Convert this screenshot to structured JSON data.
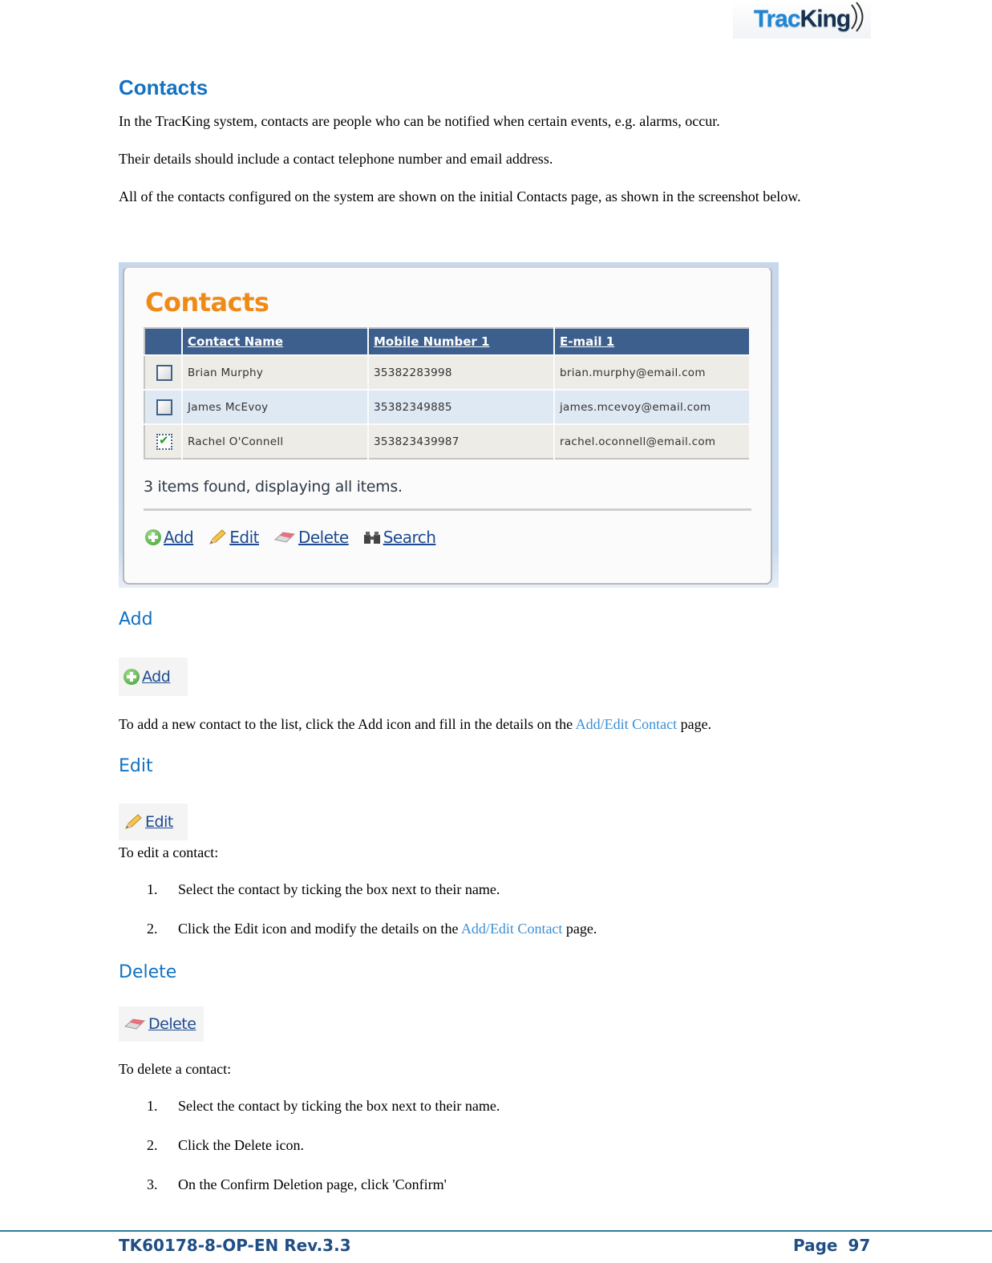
{
  "header": {
    "logo_main": "Trac",
    "logo_k": "King"
  },
  "section": {
    "title": "Contacts",
    "intro": [
      "In the TracKing system, contacts are people who can be notified when certain events, e.g. alarms, occur.",
      "Their details should include a contact telephone number and email address.",
      "All of the contacts configured on the system are shown on the initial Contacts page, as shown in the screenshot below."
    ]
  },
  "screenshot": {
    "title": "Contacts",
    "columns": [
      "Contact Name",
      "Mobile Number 1",
      "E-mail 1"
    ],
    "rows": [
      {
        "checked": false,
        "name": "Brian Murphy",
        "mobile": "35382283998",
        "email": "brian.murphy@email.com"
      },
      {
        "checked": false,
        "name": "James McEvoy",
        "mobile": "35382349885",
        "email": "james.mcevoy@email.com"
      },
      {
        "checked": true,
        "name": "Rachel O'Connell",
        "mobile": "353823439987",
        "email": "rachel.oconnell@email.com"
      }
    ],
    "count_text": "3 items found, displaying all items.",
    "actions": {
      "add": "Add",
      "edit": "Edit",
      "delete": "Delete",
      "search": "Search"
    }
  },
  "add_section": {
    "heading": "Add",
    "button_label": "Add",
    "text_before": "To add a new contact to the list, click the Add icon and fill in the details on the ",
    "link": "Add/Edit Contact",
    "text_after": " page."
  },
  "edit_section": {
    "heading": "Edit",
    "button_label": "Edit",
    "lead": "To edit a contact:",
    "steps": [
      {
        "num": "1.",
        "text": "Select the contact by ticking the box next to their name."
      },
      {
        "num": "2.",
        "text_before": "Click the Edit icon and modify the details on the ",
        "link": "Add/Edit Contact",
        "text_after": " page."
      }
    ]
  },
  "delete_section": {
    "heading": "Delete",
    "button_label": "Delete",
    "lead": "To delete a contact:",
    "steps": [
      {
        "num": "1.",
        "text": "Select the contact by ticking the box next to their name."
      },
      {
        "num": "2.",
        "text": "Click the Delete icon."
      },
      {
        "num": "3.",
        "text": "On the Confirm Deletion page, click 'Confirm'"
      }
    ]
  },
  "footer": {
    "doc_id": "TK60178-8-OP-EN Rev.3.3",
    "page_label": "Page",
    "page_number": "97"
  },
  "colors": {
    "heading_blue": "#1272c2",
    "link_blue": "#3c8fd2",
    "app_orange": "#f08a17",
    "grid_header": "#3c5f8e",
    "footer_navy": "#1f4e85"
  }
}
